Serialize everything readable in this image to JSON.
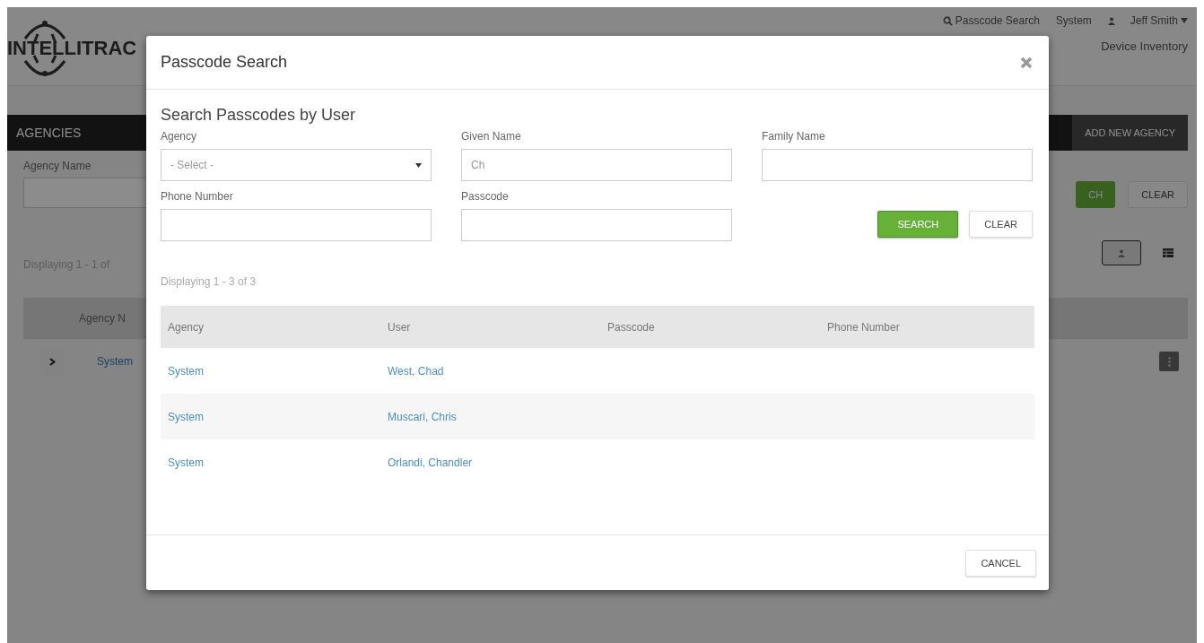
{
  "background": {
    "logo": "INTELLITRAC",
    "top_links": [
      {
        "kind": "search",
        "label": "Passcode Search"
      },
      {
        "kind": "text",
        "label": "System"
      },
      {
        "kind": "user",
        "label": "Jeff Smith"
      }
    ],
    "nav": "Device Inventory",
    "section_title": "AGENCIES",
    "add_button": "ADD NEW AGENCY",
    "filter_label": "Agency Name",
    "search_button": "CH",
    "clear_button": "CLEAR",
    "displaying": "Displaying 1 - 1 of",
    "view_toggle": [
      {
        "kind": "person",
        "selected": true
      },
      {
        "kind": "table",
        "selected": false
      }
    ],
    "table_header": "Agency N",
    "rows": [
      {
        "name": "System",
        "expanded": false
      }
    ]
  },
  "modal": {
    "title": "Passcode Search",
    "section_title": "Search Passcodes by User",
    "fields": [
      {
        "kind": "select",
        "label": "Agency",
        "value": "- Select -"
      },
      {
        "kind": "text",
        "label": "Given Name",
        "value": "Ch"
      },
      {
        "kind": "text",
        "label": "Family Name"
      },
      {
        "kind": "text",
        "label": "Phone Number"
      },
      {
        "kind": "text",
        "label": "Passcode"
      }
    ],
    "search_button": "SEARCH",
    "clear_button": "CLEAR",
    "displaying": "Displaying 1 - 3 of 3",
    "columns": [
      "Agency",
      "User",
      "Passcode",
      "Phone Number"
    ],
    "rows": [
      {
        "agency": "System",
        "user": "West, Chad"
      },
      {
        "agency": "System",
        "user": "Muscari, Chris"
      },
      {
        "agency": "System",
        "user": "Orlandi, Chandler"
      }
    ],
    "cancel_button": "CANCEL"
  }
}
